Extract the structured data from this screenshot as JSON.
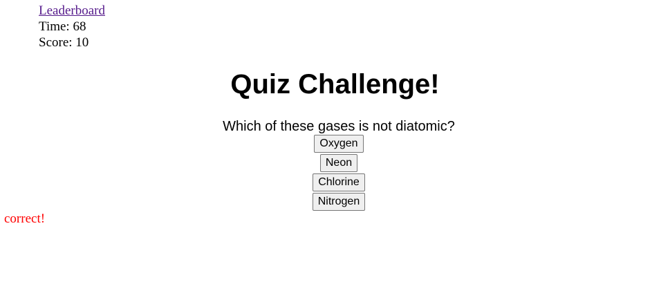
{
  "nav": {
    "leaderboard_label": "Leaderboard",
    "link_color": "#551a8b"
  },
  "status": {
    "time_text": "Time: 68",
    "score_text": "Score: 10"
  },
  "quiz": {
    "title": "Quiz Challenge!",
    "question": "Which of these gases is not diatomic?",
    "answers": [
      "Oxygen",
      "Neon",
      "Chlorine",
      "Nitrogen"
    ]
  },
  "feedback": {
    "text": "correct!",
    "color": "#ff0000"
  }
}
